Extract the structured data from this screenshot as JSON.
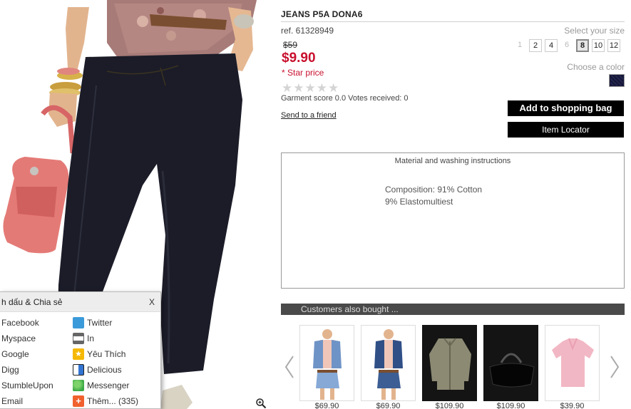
{
  "product": {
    "title": "JEANS P5A DONA6",
    "ref": "ref. 61328949",
    "old_price": "$59",
    "price": "$9.90",
    "star_price": "* Star price",
    "rating_stars": 5,
    "rating_value": 0,
    "score_text": "Garment score 0.0 Votes received: 0",
    "send_friend": "Send to a friend"
  },
  "size": {
    "label": "Select your size",
    "options": [
      {
        "label": "1",
        "available": false
      },
      {
        "label": "2",
        "available": true
      },
      {
        "label": "4",
        "available": true
      },
      {
        "label": "6",
        "available": false
      },
      {
        "label": "8",
        "available": true,
        "selected": true
      },
      {
        "label": "10",
        "available": true
      },
      {
        "label": "12",
        "available": true
      }
    ]
  },
  "color": {
    "label": "Choose a color",
    "swatch": "#17183a"
  },
  "buttons": {
    "add_bag": "Add to shopping bag",
    "locator": "Item Locator"
  },
  "material": {
    "title": "Material and washing instructions",
    "composition_line1": "Composition: 91% Cotton",
    "composition_line2": "9% Elastomultiest"
  },
  "also_bought": {
    "title": "Customers also bought ...",
    "items": [
      {
        "price": "$69.90",
        "icon": "denim-vest-outfit"
      },
      {
        "price": "$69.90",
        "icon": "denim-vest-outfit"
      },
      {
        "price": "$109.90",
        "icon": "khaki-jacket"
      },
      {
        "price": "$109.90",
        "icon": "black-duffel-bag"
      },
      {
        "price": "$39.90",
        "icon": "pink-polo-shirt"
      }
    ]
  },
  "share": {
    "title": "h dấu & Chia sẻ",
    "close": "X",
    "left": [
      "Facebook",
      "Myspace",
      "Google",
      "Digg",
      "StumbleUpon",
      "Email"
    ],
    "right": [
      {
        "label": "Twitter",
        "icon": "twitter-icon",
        "color": "#3b9ad9"
      },
      {
        "label": "In",
        "icon": "print-icon",
        "color": "#666666"
      },
      {
        "label": "Yêu Thích",
        "icon": "favorite-star-icon",
        "color": "#f5b800"
      },
      {
        "label": "Delicious",
        "icon": "delicious-icon",
        "color": "#3274d1"
      },
      {
        "label": "Messenger",
        "icon": "messenger-icon",
        "color": "#3aa845"
      },
      {
        "label": "Thêm... (335)",
        "icon": "more-plus-icon",
        "color": "#f0612e"
      }
    ]
  }
}
